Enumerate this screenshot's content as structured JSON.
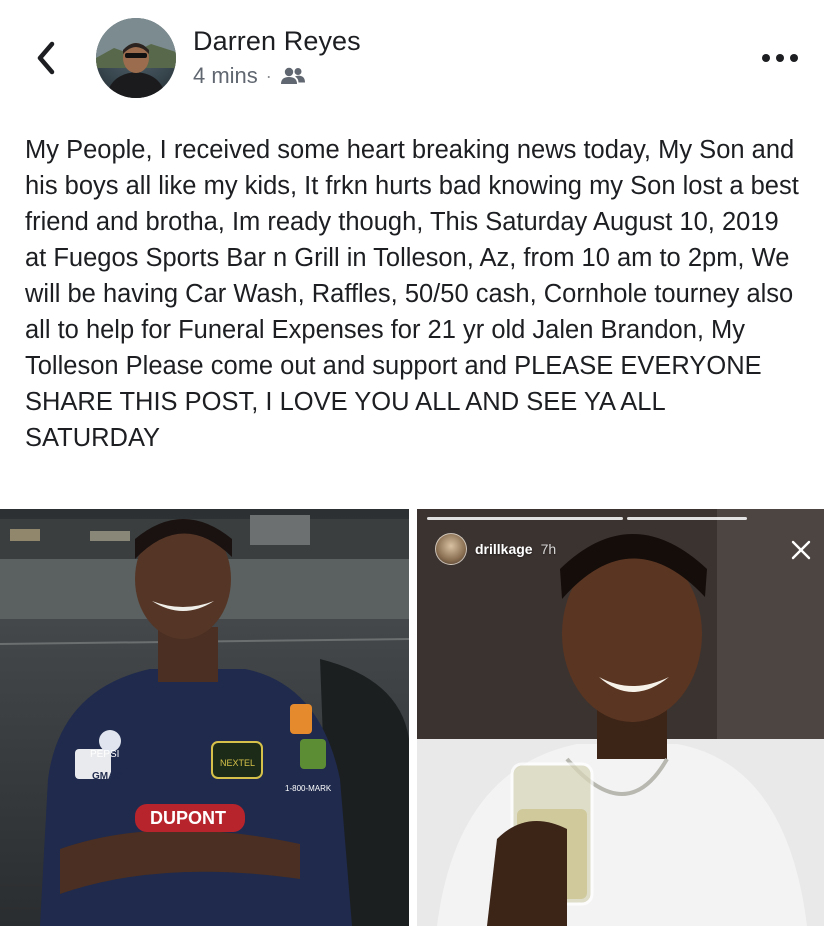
{
  "post": {
    "author": "Darren Reyes",
    "time": "4 mins",
    "separator": "·",
    "audience_icon": "friends-icon",
    "text": "My People, I received some heart breaking news today, My Son and his boys all like my kids, It frkn hurts bad knowing my Son lost a best friend and brotha, Im ready though, This Saturday August 10, 2019 at Fuegos Sports Bar n Grill in Tolleson, Az, from 10 am to 2pm, We will be having Car Wash, Raffles, 50/50 cash, Cornhole tourney also all to help for Funeral Expenses for 21 yr old Jalen Brandon, My Tolleson Please come out and support and PLEASE EVERYONE SHARE THIS POST, I LOVE YOU ALL AND SEE YA ALL SATURDAY"
  },
  "header": {
    "back_icon": "chevron-left-icon",
    "more_icon": "more-horizontal-icon"
  },
  "photos": {
    "left": {
      "shirt_text_1": "PEPSI",
      "shirt_text_2": "GMAC",
      "shirt_text_3": "NEXTEL",
      "shirt_text_4": "1-800-MARK",
      "shirt_text_5": "DUPONT"
    },
    "right": {
      "story_username": "drillkage",
      "story_time": "7h",
      "close_icon": "close-icon"
    }
  },
  "colors": {
    "text_primary": "#1c1e21",
    "text_secondary": "#616770",
    "shirt_navy": "#1f2a4d",
    "story_bg": "#3b3330"
  }
}
